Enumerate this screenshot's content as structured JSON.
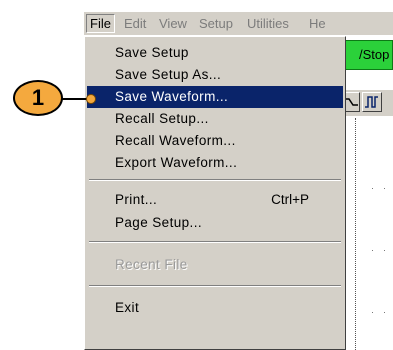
{
  "menubar": {
    "items": [
      "File",
      "Edit",
      "View",
      "Setup",
      "Utilities",
      "He"
    ]
  },
  "toolbar": {
    "run_stop_label": "/Stop"
  },
  "file_menu": {
    "items": [
      {
        "label": "Save Setup"
      },
      {
        "label": "Save Setup As..."
      },
      {
        "label": "Save Waveform..."
      },
      {
        "label": "Recall Setup..."
      },
      {
        "label": "Recall Waveform..."
      },
      {
        "label": "Export Waveform..."
      },
      {
        "label": "Print...",
        "shortcut": "Ctrl+P"
      },
      {
        "label": "Page Setup..."
      },
      {
        "label": "Recent File"
      },
      {
        "label": "Exit"
      }
    ]
  },
  "callout": {
    "number": "1"
  },
  "colors": {
    "selection": "#0a246a",
    "callout": "#f4a93e",
    "run_stop": "#2bd13a",
    "menu_bg": "#d4d0c8"
  }
}
